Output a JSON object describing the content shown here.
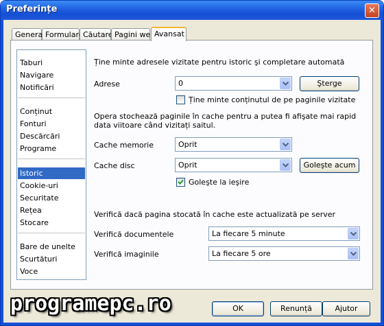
{
  "window": {
    "title": "Preferințe",
    "close_glyph": "✕"
  },
  "tabs": [
    "General",
    "Formulare",
    "Căutare",
    "Pagini web",
    "Avansat"
  ],
  "active_tab": "Avansat",
  "sidebar": {
    "groups": [
      [
        "Taburi",
        "Navigare",
        "Notificări"
      ],
      [
        "Conținut",
        "Fonturi",
        "Descărcări",
        "Programe"
      ],
      [
        "Istoric",
        "Cookie-uri",
        "Securitate",
        "Rețea",
        "Stocare"
      ],
      [
        "Bare de unelte",
        "Scurtături",
        "Voce"
      ]
    ],
    "selected": "Istoric"
  },
  "history": {
    "heading": "Ține minte adresele vizitate pentru istoric şi completare automată",
    "addresses_label": "Adrese",
    "addresses_value": "0",
    "delete_button": "Şterge",
    "remember_content_label": "Ține minte conținutul de pe paginile vizitate",
    "remember_content_checked": false
  },
  "cache": {
    "description_line1": "Opera stochează paginile în cache pentru a putea fi afişate mai rapid",
    "description_line2": "data viitoare când vizitați saitul.",
    "memory_label": "Cache memorie",
    "memory_value": "Oprit",
    "disk_label": "Cache disc",
    "disk_value": "Oprit",
    "empty_button": "Goleşte acum",
    "empty_on_exit_label": "Goleşte la ieşire",
    "empty_on_exit_checked": true
  },
  "check": {
    "heading": "Verifică dacă pagina stocată în cache este actualizată pe server",
    "documents_label": "Verifică documentele",
    "documents_value": "La fiecare 5 minute",
    "images_label": "Verifică imaginile",
    "images_value": "La fiecare 5 ore"
  },
  "footer": {
    "ok": "OK",
    "cancel": "Renunță",
    "help": "Ajutor"
  },
  "watermark": "programepc.ro",
  "icons": {
    "dropdown": "chevron-down-icon",
    "check": "checkmark-icon",
    "close": "close-icon"
  }
}
